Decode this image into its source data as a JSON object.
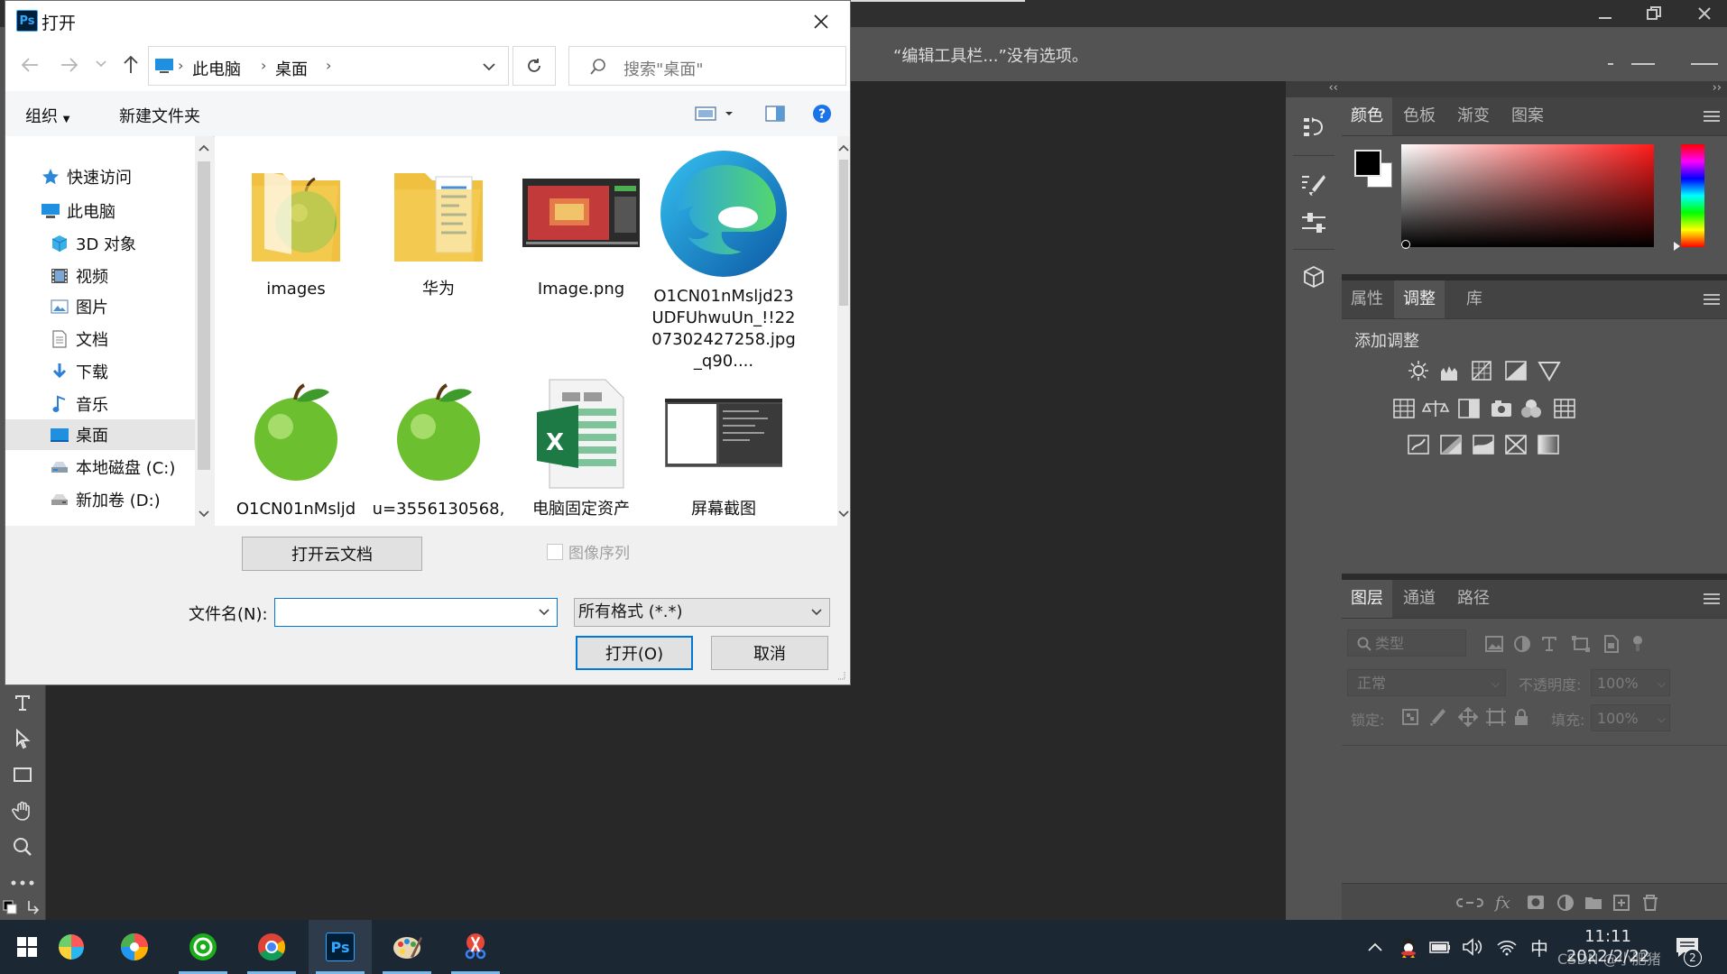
{
  "photoshop": {
    "options_bar": {
      "message": "“编辑工具栏...”没有选项。"
    },
    "color_panel": {
      "tabs": [
        "颜色",
        "色板",
        "渐变",
        "图案"
      ],
      "active_tab": 0
    },
    "adjust_panel": {
      "tabs": [
        "属性",
        "调整",
        "库"
      ],
      "active_tab": 1,
      "heading": "添加调整"
    },
    "layers_panel": {
      "tabs": [
        "图层",
        "通道",
        "路径"
      ],
      "active_tab": 0,
      "filter_placeholder": "类型",
      "blend_mode": "正常",
      "opacity_label": "不透明度:",
      "opacity_value": "100%",
      "lock_label": "锁定:",
      "fill_label": "填充:",
      "fill_value": "100%"
    },
    "colors": {
      "ui_bg": "#535353",
      "canvas_bg": "#282828",
      "foreground": "#000000",
      "background": "#ffffff"
    }
  },
  "dialog": {
    "title": "打开",
    "address": {
      "crumbs": [
        "此电脑",
        "桌面"
      ]
    },
    "search_placeholder": "搜索\"桌面\"",
    "commands": {
      "organize": "组织",
      "new_folder": "新建文件夹"
    },
    "nav_items": [
      {
        "label": "快速访问",
        "icon": "star-icon"
      },
      {
        "label": "此电脑",
        "icon": "computer-icon"
      },
      {
        "label": "3D 对象",
        "icon": "cube-3d-icon"
      },
      {
        "label": "视频",
        "icon": "video-icon"
      },
      {
        "label": "图片",
        "icon": "picture-icon"
      },
      {
        "label": "文档",
        "icon": "document-icon"
      },
      {
        "label": "下载",
        "icon": "download-icon"
      },
      {
        "label": "音乐",
        "icon": "music-icon"
      },
      {
        "label": "桌面",
        "icon": "desktop-icon"
      },
      {
        "label": "本地磁盘 (C:)",
        "icon": "drive-icon"
      },
      {
        "label": "新加卷 (D:)",
        "icon": "drive-icon"
      }
    ],
    "selected_nav": "桌面",
    "files": [
      {
        "name": "images",
        "kind": "folder-apple"
      },
      {
        "name": "华为",
        "kind": "folder-doc"
      },
      {
        "name": "Image.png",
        "kind": "image"
      },
      {
        "name": "O1CN01nMsljd23UDFUhwuUn_!!2207302427258.jpg_q90....",
        "kind": "edge"
      },
      {
        "name": "O1CN01nMsljd",
        "kind": "apple"
      },
      {
        "name": "u=3556130568,",
        "kind": "apple"
      },
      {
        "name": "电脑固定资产",
        "kind": "excel"
      },
      {
        "name": "屏幕截图",
        "kind": "screenshot"
      }
    ],
    "cloud_button": "打开云文档",
    "image_sequence": "图像序列",
    "filename_label": "文件名(N):",
    "filename_value": "",
    "filetype": "所有格式 (*.*)",
    "open_button": "打开(O)",
    "cancel_button": "取消"
  },
  "taskbar": {
    "clock_time": "11:11",
    "clock_date": "2022/2/22",
    "ime": "中",
    "watermark": "CSDN @小肥猪",
    "notification_count": "2"
  }
}
